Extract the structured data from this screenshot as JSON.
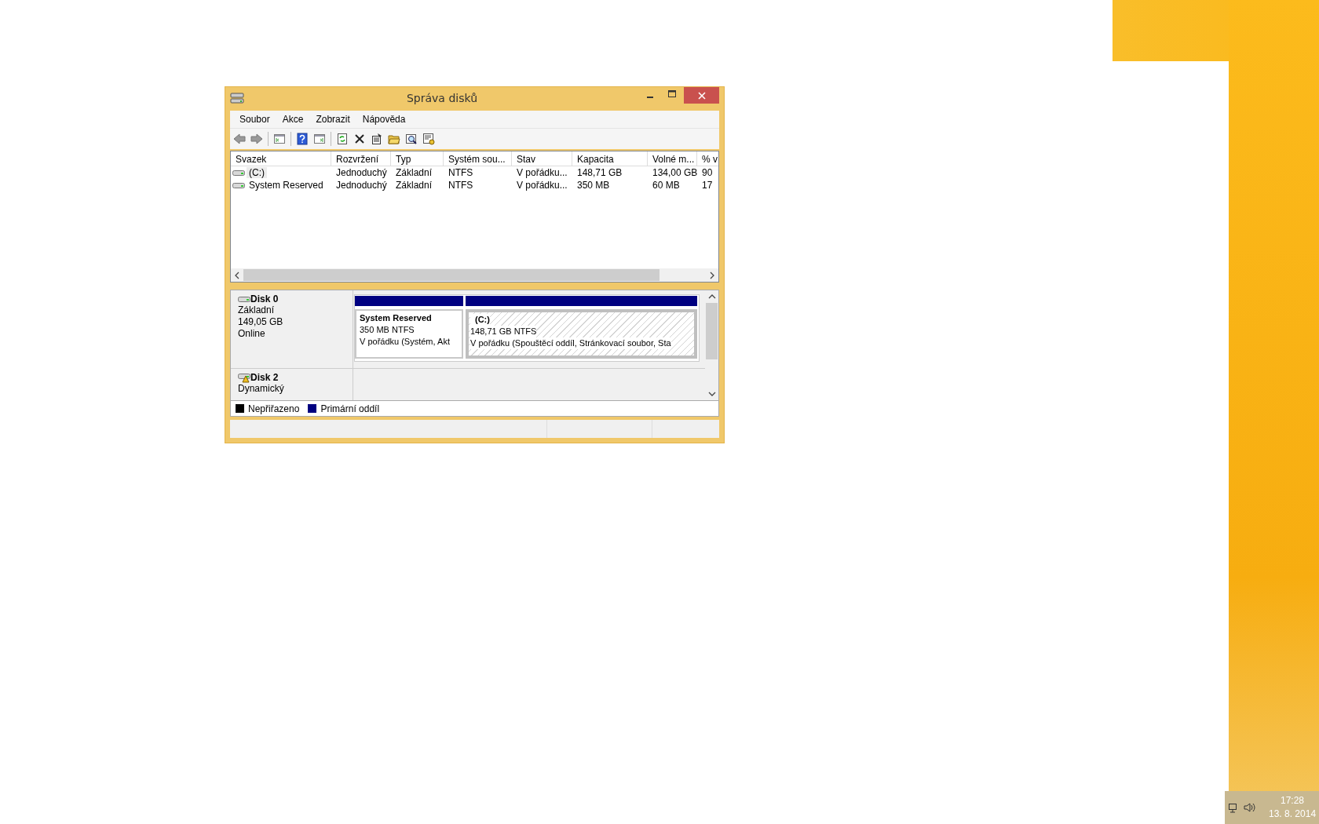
{
  "window": {
    "title": "Správa disků"
  },
  "menu": [
    "Soubor",
    "Akce",
    "Zobrazit",
    "Nápověda"
  ],
  "volumes": {
    "columns": [
      "Svazek",
      "Rozvržení",
      "Typ",
      "Systém sou...",
      "Stav",
      "Kapacita",
      "Volné m...",
      "% v"
    ],
    "rows": [
      {
        "selected": true,
        "cells": [
          "(C:)",
          "Jednoduchý",
          "Základní",
          "NTFS",
          "V pořádku...",
          "148,71 GB",
          "134,00 GB",
          "90"
        ]
      },
      {
        "selected": false,
        "cells": [
          "System Reserved",
          "Jednoduchý",
          "Základní",
          "NTFS",
          "V pořádku...",
          "350 MB",
          "60 MB",
          "17"
        ]
      }
    ]
  },
  "disks": [
    {
      "name": "Disk 0",
      "warning": false,
      "lines": [
        "Základní",
        "149,05 GB",
        "Online"
      ],
      "partitions": [
        {
          "selected": false,
          "color": "#000080",
          "name": "System Reserved",
          "lines": [
            "350 MB NTFS",
            "V pořádku (Systém, Akt"
          ]
        },
        {
          "selected": true,
          "color": "#000080",
          "name": "(C:)",
          "lines": [
            "148,71 GB NTFS",
            "V pořádku (Spouštěcí oddíl, Stránkovací soubor, Sta"
          ]
        }
      ]
    },
    {
      "name": "Disk 2",
      "warning": true,
      "lines": [
        "Dynamický"
      ]
    }
  ],
  "legend": [
    {
      "label": "Nepřiřazeno",
      "color": "#000000"
    },
    {
      "label": "Primární oddíl",
      "color": "#000080"
    }
  ],
  "taskbar": {
    "time": "17:28",
    "date": "13. 8. 2014"
  }
}
